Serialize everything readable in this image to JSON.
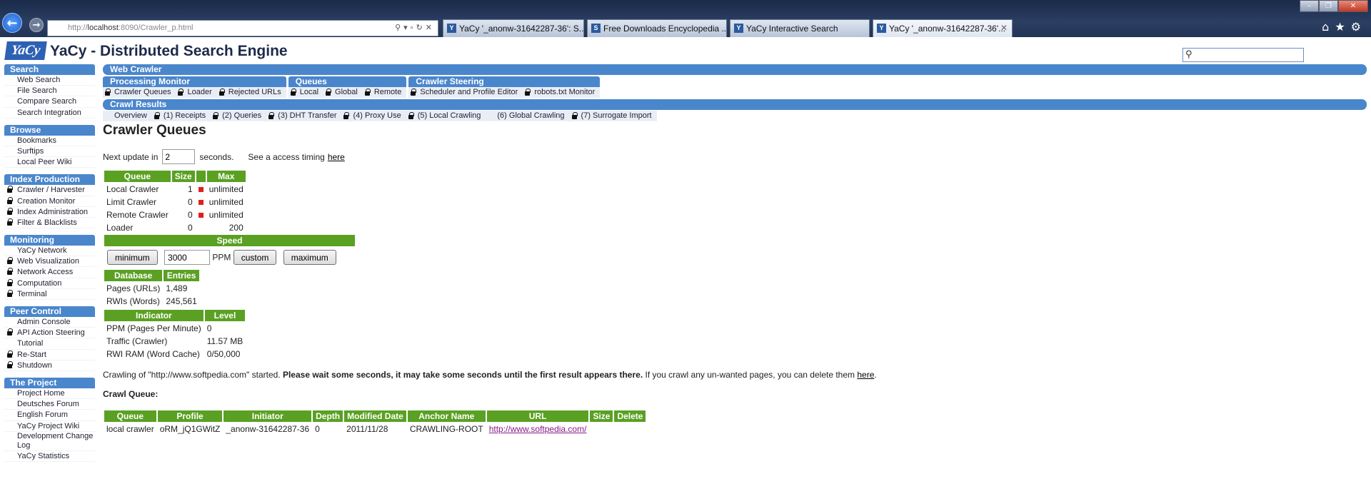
{
  "browser": {
    "url_prefix": "http://",
    "url_host": "localhost",
    "url_rest": ":8090/Crawler_p.html",
    "tabs": [
      {
        "label": "YaCy '_anonw-31642287-36': S...",
        "icon": "Y"
      },
      {
        "label": "Free Downloads Encyclopedia ...",
        "icon": "S"
      },
      {
        "label": "YaCy Interactive Search",
        "icon": "Y"
      },
      {
        "label": "YaCy '_anonw-31642287-36'...",
        "icon": "Y"
      }
    ],
    "close_glyph": "✕"
  },
  "header": {
    "logo": "YaCy",
    "title": "YaCy - Distributed Search Engine"
  },
  "sidebar": [
    {
      "title": "Search",
      "items": [
        {
          "label": "Web Search",
          "lock": false
        },
        {
          "label": "File Search",
          "lock": false
        },
        {
          "label": "Compare Search",
          "lock": false
        },
        {
          "label": "Search Integration",
          "lock": false
        }
      ]
    },
    {
      "title": "Browse",
      "items": [
        {
          "label": "Bookmarks",
          "lock": false
        },
        {
          "label": "Surftips",
          "lock": false
        },
        {
          "label": "Local Peer Wiki",
          "lock": false
        }
      ]
    },
    {
      "title": "Index Production",
      "items": [
        {
          "label": "Crawler / Harvester",
          "lock": true
        },
        {
          "label": "Creation Monitor",
          "lock": true
        },
        {
          "label": "Index Administration",
          "lock": true
        },
        {
          "label": "Filter & Blacklists",
          "lock": true
        }
      ]
    },
    {
      "title": "Monitoring",
      "items": [
        {
          "label": "YaCy Network",
          "lock": false
        },
        {
          "label": "Web Visualization",
          "lock": true
        },
        {
          "label": "Network Access",
          "lock": true
        },
        {
          "label": "Computation",
          "lock": true
        },
        {
          "label": "Terminal",
          "lock": true
        }
      ]
    },
    {
      "title": "Peer Control",
      "items": [
        {
          "label": "Admin Console",
          "lock": false
        },
        {
          "label": "API Action Steering",
          "lock": true
        },
        {
          "label": "Tutorial",
          "lock": false
        },
        {
          "label": "Re-Start",
          "lock": true
        },
        {
          "label": "Shutdown",
          "lock": true
        }
      ]
    },
    {
      "title": "The Project",
      "items": [
        {
          "label": "Project Home",
          "lock": false
        },
        {
          "label": "Deutsches Forum",
          "lock": false
        },
        {
          "label": "English Forum",
          "lock": false
        },
        {
          "label": "YaCy Project Wiki",
          "lock": false
        },
        {
          "label": "Development Change Log",
          "lock": false
        },
        {
          "label": "YaCy Statistics",
          "lock": false
        }
      ]
    }
  ],
  "menu": {
    "web_crawler": "Web Crawler",
    "processing": {
      "title": "Processing Monitor",
      "items": [
        {
          "label": "Crawler Queues",
          "lock": true
        },
        {
          "label": "Loader",
          "lock": true
        },
        {
          "label": "Rejected URLs",
          "lock": true
        }
      ]
    },
    "queues": {
      "title": "Queues",
      "items": [
        {
          "label": "Local",
          "lock": true
        },
        {
          "label": "Global",
          "lock": true
        },
        {
          "label": "Remote",
          "lock": true
        }
      ]
    },
    "steering": {
      "title": "Crawler Steering",
      "items": [
        {
          "label": "Scheduler and Profile Editor",
          "lock": true
        },
        {
          "label": "robots.txt Monitor",
          "lock": true
        }
      ]
    },
    "crawl_results": {
      "title": "Crawl Results",
      "items": [
        {
          "label": "Overview",
          "lock": false
        },
        {
          "label": "(1) Receipts",
          "lock": true
        },
        {
          "label": "(2) Queries",
          "lock": true
        },
        {
          "label": "(3) DHT Transfer",
          "lock": true
        },
        {
          "label": "(4) Proxy Use",
          "lock": true
        },
        {
          "label": "(5) Local Crawling",
          "lock": true
        },
        {
          "label": "(6) Global Crawling",
          "lock": false
        },
        {
          "label": "(7) Surrogate Import",
          "lock": true
        }
      ]
    }
  },
  "content": {
    "heading": "Crawler Queues",
    "update_prefix": "Next update in",
    "update_value": "2",
    "update_suffix": "seconds.",
    "timing_text": "See a access timing",
    "timing_link": "here",
    "queue_table": {
      "headers": [
        "Queue",
        "Size",
        "",
        "Max"
      ],
      "rows": [
        {
          "queue": "Local Crawler",
          "size": "1",
          "flag": true,
          "max": "unlimited"
        },
        {
          "queue": "Limit Crawler",
          "size": "0",
          "flag": true,
          "max": "unlimited"
        },
        {
          "queue": "Remote Crawler",
          "size": "0",
          "flag": true,
          "max": "unlimited"
        },
        {
          "queue": "Loader",
          "size": "0",
          "flag": false,
          "max": "200"
        }
      ]
    },
    "speed": {
      "title": "Speed",
      "minimum": "minimum",
      "value": "3000",
      "unit": "PPM",
      "custom": "custom",
      "maximum": "maximum"
    },
    "db_table": {
      "headers": [
        "Database",
        "Entries"
      ],
      "rows": [
        [
          "Pages (URLs)",
          "1,489"
        ],
        [
          "RWIs (Words)",
          "245,561"
        ]
      ]
    },
    "indicator_table": {
      "headers": [
        "Indicator",
        "Level"
      ],
      "rows": [
        [
          "PPM (Pages Per Minute)",
          "0"
        ],
        [
          "Traffic (Crawler)",
          "11.57 MB"
        ],
        [
          "RWI RAM (Word Cache)",
          "0/50,000"
        ]
      ]
    },
    "message": {
      "pre": "Crawling of \"http://www.softpedia.com\" started.",
      "bold": "Please wait some seconds, it may take some seconds until the first result appears there.",
      "post": "If you crawl any un-wanted pages, you can delete them",
      "link": "here",
      "end": "."
    },
    "crawl_queue": {
      "title": "Crawl Queue:",
      "headers": [
        "Queue",
        "Profile",
        "Initiator",
        "Depth",
        "Modified Date",
        "Anchor Name",
        "URL",
        "Size",
        "Delete"
      ],
      "rows": [
        [
          "local crawler",
          "oRM_jQ1GWitZ",
          "_anonw-31642287-36",
          "0",
          "2011/11/28",
          "CRAWLING-ROOT",
          "http://www.softpedia.com/",
          "",
          ""
        ]
      ]
    }
  }
}
